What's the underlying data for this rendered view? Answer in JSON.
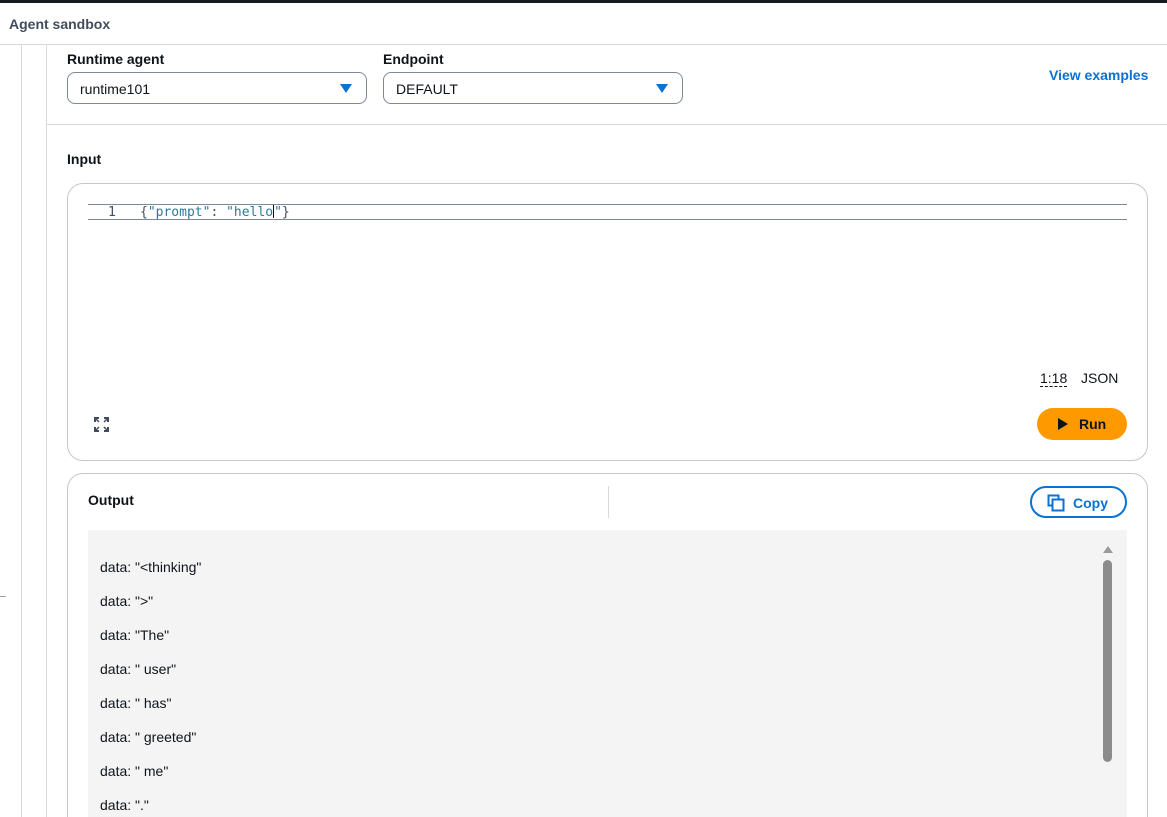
{
  "header": {
    "title": "Agent sandbox"
  },
  "runtime_agent": {
    "label": "Runtime agent",
    "value": "runtime101"
  },
  "endpoint": {
    "label": "Endpoint",
    "value": "DEFAULT"
  },
  "view_examples": "View examples",
  "input": {
    "title": "Input",
    "line_number": "1",
    "code": {
      "open": "{",
      "key": "\"prompt\"",
      "colon": ": ",
      "value_before_cursor": "\"hello",
      "value_after_cursor": "\"",
      "close": "}"
    },
    "cursor_position": "1:18",
    "language": "JSON",
    "run_label": "Run"
  },
  "output": {
    "title": "Output",
    "copy_label": "Copy",
    "lines": [
      "data: \"<thinking\"",
      "data: \">\"",
      "data: \"The\"",
      "data: \" user\"",
      "data: \" has\"",
      "data: \" greeted\"",
      "data: \" me\"",
      "data: \".\""
    ]
  },
  "colors": {
    "accent": "#0972d3",
    "run": "#ff9900",
    "text": "#0f141a"
  }
}
